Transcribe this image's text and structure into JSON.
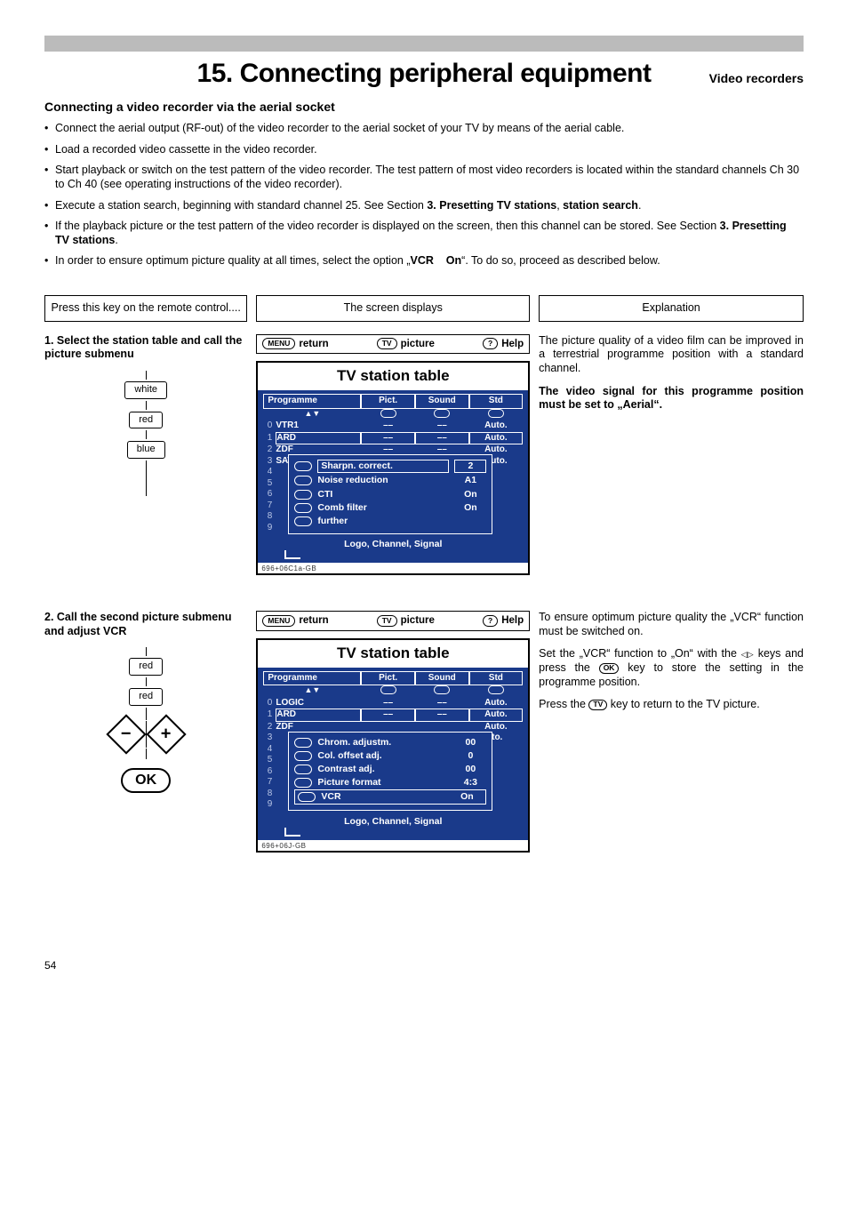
{
  "page": {
    "number": "54",
    "main_title": "15. Connecting peripheral equipment",
    "side_title": "Video recorders",
    "section_heading": "Connecting a video recorder via the aerial socket",
    "bullets": [
      {
        "parts": [
          "Connect the aerial output (RF-out) of the video recorder to the aerial socket of your TV by means of the aerial cable."
        ]
      },
      {
        "parts": [
          "Load a recorded video cassette in the video recorder."
        ]
      },
      {
        "parts": [
          "Start playback or switch on the test pattern of the video recorder. The test pattern of most video recorders is located within the standard channels Ch 30 to Ch 40 (see operating instructions of the video recorder)."
        ]
      },
      {
        "parts": [
          "Execute a station search, beginning with standard channel 25. See Section ",
          {
            "b": "3. Presetting TV stations"
          },
          ", ",
          {
            "b": "station search"
          },
          "."
        ]
      },
      {
        "parts": [
          "If the playback picture or the test pattern of the video recorder is displayed on the screen, then this channel can be stored. See Section ",
          {
            "b": "3. Presetting TV stations"
          },
          "."
        ]
      },
      {
        "parts": [
          "In order to ensure optimum picture quality at all times, select the option „",
          {
            "b": "VCR    On"
          },
          "“. To do so, proceed as described below."
        ]
      }
    ]
  },
  "headers": {
    "left": "Press this key on the remote control....",
    "mid": "The screen displays",
    "right": "Explanation"
  },
  "step1": {
    "title": "1. Select the station table and call the picture submenu",
    "key_labels": [
      "white",
      "red",
      "blue"
    ],
    "osd_bar": {
      "left_key": "MENU",
      "left_label": "return",
      "mid_key": "TV",
      "mid_label": "picture",
      "right_key": "?",
      "right_label": "Help"
    },
    "osd_title": "TV station table",
    "col_headers": {
      "prog": "Programme",
      "pict": "Pict.",
      "sound": "Sound",
      "std": "Std"
    },
    "rows": [
      {
        "n": "0",
        "ch": "VTR1",
        "pict": "––",
        "sound": "––",
        "std": "Auto."
      },
      {
        "n": "1",
        "ch": "ARD",
        "pict": "––",
        "sound": "––",
        "std": "Auto."
      },
      {
        "n": "2",
        "ch": "ZDF",
        "pict": "––",
        "sound": "––",
        "std": "Auto."
      },
      {
        "n": "3",
        "ch": "SAT 1",
        "pict": "",
        "sound": "",
        "std": "Auto."
      },
      {
        "n": "4",
        "ch": "",
        "pict": "",
        "sound": "",
        "std": ""
      },
      {
        "n": "5",
        "ch": "",
        "pict": "",
        "sound": "",
        "std": ""
      },
      {
        "n": "6",
        "ch": "",
        "pict": "",
        "sound": "",
        "std": ""
      },
      {
        "n": "7",
        "ch": "",
        "pict": "",
        "sound": "",
        "std": ""
      },
      {
        "n": "8",
        "ch": "",
        "pict": "",
        "sound": "",
        "std": ""
      },
      {
        "n": "9",
        "ch": "",
        "pict": "",
        "sound": "",
        "std": ""
      }
    ],
    "popup": [
      {
        "lab": "Sharpn. correct.",
        "val": "2",
        "boxed": true
      },
      {
        "lab": "Noise reduction",
        "val": "A1"
      },
      {
        "lab": "CTI",
        "val": "On"
      },
      {
        "lab": "Comb filter",
        "val": "On"
      },
      {
        "lab": "further",
        "val": ""
      }
    ],
    "footer": "Logo, Channel, Signal",
    "code": "696+06C1a-GB",
    "right_paras": [
      "The picture quality of a video film can be improved in a terrestrial programme position with a standard channel.",
      {
        "b": "The video signal for this programme position must be set to „Aerial“."
      }
    ]
  },
  "step2": {
    "title": "2. Call the second picture submenu and adjust VCR",
    "key_labels": [
      "red",
      "red"
    ],
    "ok_label": "OK",
    "osd_bar": {
      "left_key": "MENU",
      "left_label": "return",
      "mid_key": "TV",
      "mid_label": "picture",
      "right_key": "?",
      "right_label": "Help"
    },
    "osd_title": "TV station table",
    "col_headers": {
      "prog": "Programme",
      "pict": "Pict.",
      "sound": "Sound",
      "std": "Std"
    },
    "rows": [
      {
        "n": "0",
        "ch": "LOGIC",
        "pict": "––",
        "sound": "––",
        "std": "Auto."
      },
      {
        "n": "1",
        "ch": "ARD",
        "pict": "––",
        "sound": "––",
        "std": "Auto."
      },
      {
        "n": "2",
        "ch": "ZDF",
        "pict": "",
        "sound": "",
        "std": "Auto."
      },
      {
        "n": "3",
        "ch": "",
        "pict": "",
        "sound": "",
        "std": "ıto."
      },
      {
        "n": "4",
        "ch": "",
        "pict": "",
        "sound": "",
        "std": ""
      },
      {
        "n": "5",
        "ch": "",
        "pict": "",
        "sound": "",
        "std": ""
      },
      {
        "n": "6",
        "ch": "",
        "pict": "",
        "sound": "",
        "std": ""
      },
      {
        "n": "7",
        "ch": "",
        "pict": "",
        "sound": "",
        "std": ""
      },
      {
        "n": "8",
        "ch": "",
        "pict": "",
        "sound": "",
        "std": ""
      },
      {
        "n": "9",
        "ch": "",
        "pict": "",
        "sound": "",
        "std": ""
      }
    ],
    "popup": [
      {
        "lab": "Chrom. adjustm.",
        "val": "00"
      },
      {
        "lab": "Col. offset adj.",
        "val": "0"
      },
      {
        "lab": "Contrast adj.",
        "val": "00"
      },
      {
        "lab": "Picture format",
        "val": "4:3"
      },
      {
        "lab": "VCR",
        "val": "On",
        "boxed2": true
      }
    ],
    "footer": "Logo, Channel, Signal",
    "code": "696+06J-GB",
    "right_text": {
      "p1_a": "To ensure optimum picture quality the „VCR“ function must be switched on.",
      "p2_a": "Set the „VCR“ function to „On“ with the ",
      "p2_b": " keys and press the ",
      "p2_key1": "OK",
      "p2_c": " key to store the setting in the programme position.",
      "p3_a": "Press the ",
      "p3_key": "TV",
      "p3_b": " key to return to the TV picture."
    }
  }
}
